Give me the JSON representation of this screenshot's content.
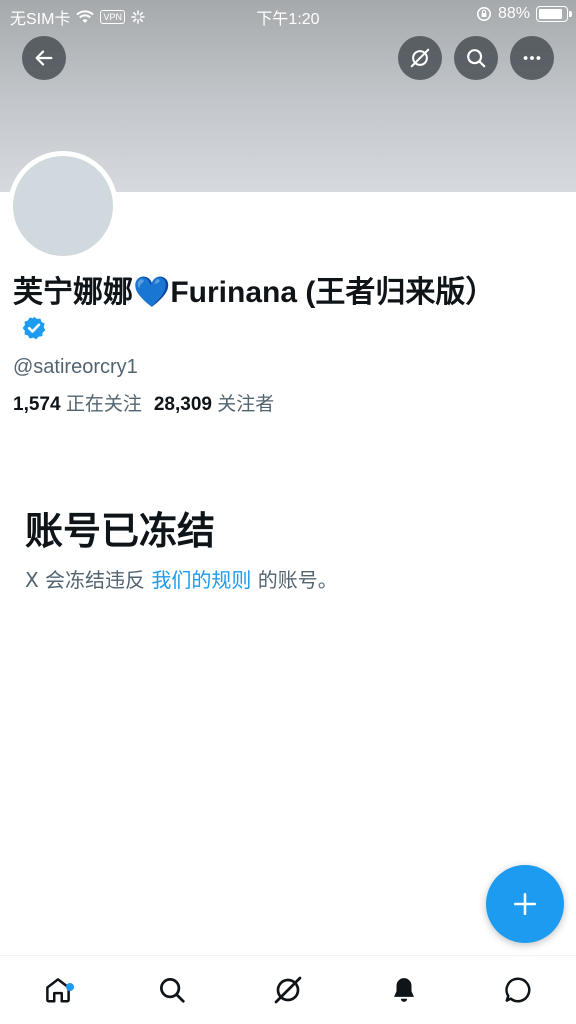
{
  "status_bar": {
    "carrier": "无SIM卡",
    "vpn": "VPN",
    "time": "下午1:20",
    "battery": "88%",
    "battery_level": 0.88
  },
  "header": {
    "back_icon": "arrow-left-icon",
    "grok_icon": "grok-icon",
    "search_icon": "search-icon",
    "more_icon": "more-icon"
  },
  "profile": {
    "display_name": "芙宁娜娜💙Furinana (王者归来版）",
    "verified_icon": "verified-badge-icon",
    "handle": "@satireorcry1",
    "following_count": "1,574",
    "following_label": "正在关注",
    "followers_count": "28,309",
    "followers_label": "关注者"
  },
  "suspended": {
    "title": "账号已冻结",
    "desc_prefix": "X 会冻结违反 ",
    "rules_link": "我们的规则",
    "desc_suffix": " 的账号。"
  },
  "fab": {
    "icon": "plus-icon"
  },
  "bottom_nav": {
    "items": [
      {
        "icon": "home-icon",
        "has_badge": true
      },
      {
        "icon": "search-icon"
      },
      {
        "icon": "grok-icon"
      },
      {
        "icon": "bell-icon"
      },
      {
        "icon": "messages-icon"
      }
    ]
  },
  "colors": {
    "accent": "#1d9bf0",
    "text_primary": "#0f1419",
    "text_secondary": "#536471",
    "header_button_bg": "#40464c"
  }
}
